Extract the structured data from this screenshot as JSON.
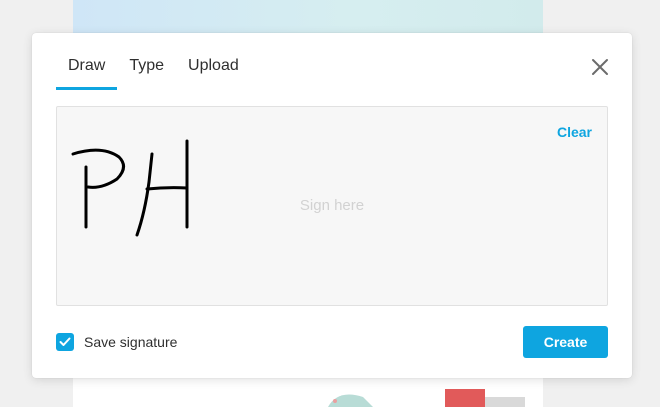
{
  "dialog": {
    "tabs": [
      {
        "label": "Draw",
        "active": true
      },
      {
        "label": "Type",
        "active": false
      },
      {
        "label": "Upload",
        "active": false
      }
    ],
    "close_icon": "close-icon"
  },
  "signature_pad": {
    "clear_label": "Clear",
    "placeholder": "Sign here"
  },
  "footer": {
    "save_label": "Save signature",
    "save_checked": true,
    "create_label": "Create"
  },
  "colors": {
    "accent": "#0ea5e0",
    "ink": "#000000"
  }
}
